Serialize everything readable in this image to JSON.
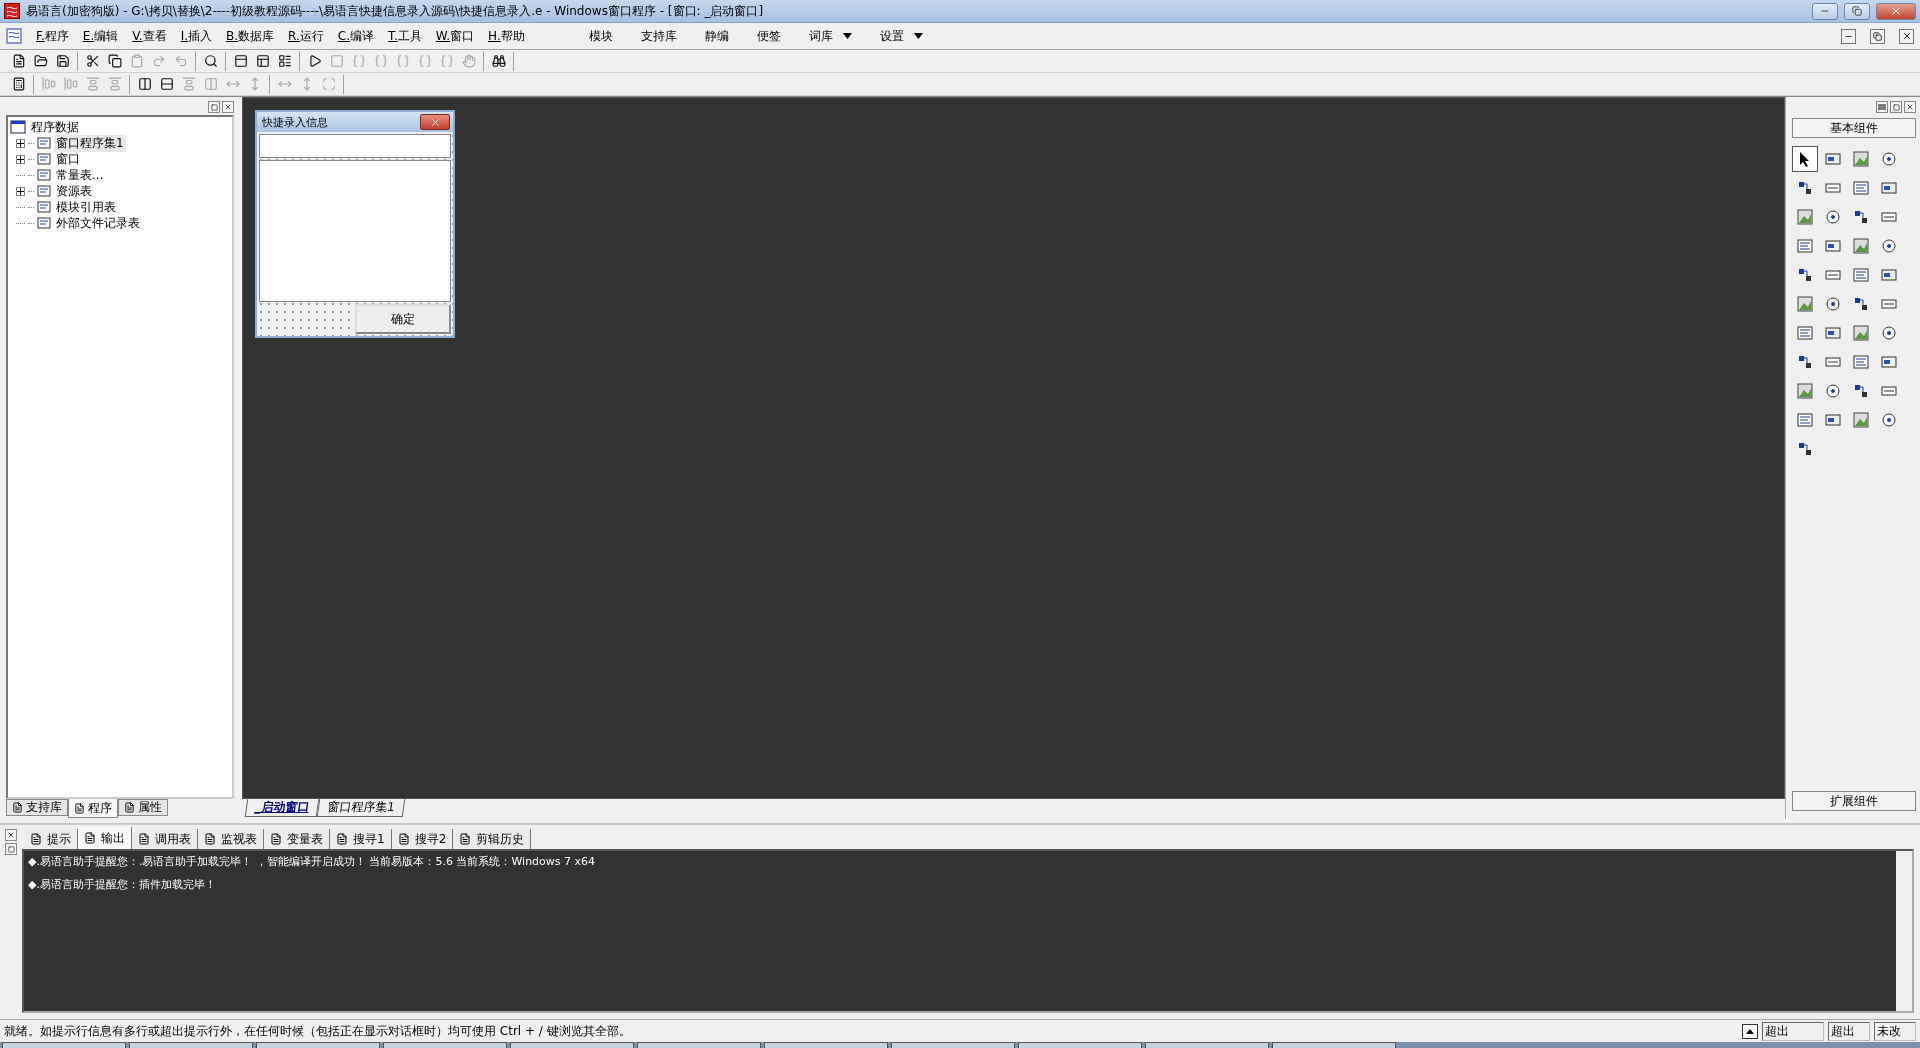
{
  "window": {
    "title": "易语言(加密狗版) - G:\\拷贝\\替换\\2----初级教程源码----\\易语言快捷信息录入源码\\快捷信息录入.e - Windows窗口程序 - [窗口: _启动窗口]"
  },
  "menu": {
    "items": [
      "F.程序",
      "E.编辑",
      "V.查看",
      "I.插入",
      "B.数据库",
      "R.运行",
      "C.编译",
      "T.工具",
      "W.窗口",
      "H.帮助"
    ],
    "extras": [
      {
        "label": "模块",
        "dropdown": false
      },
      {
        "label": "支持库",
        "dropdown": false
      },
      {
        "label": "静编",
        "dropdown": false
      },
      {
        "label": "便签",
        "dropdown": false
      },
      {
        "label": "词库",
        "dropdown": true
      },
      {
        "label": "设置",
        "dropdown": true
      }
    ]
  },
  "toolbars": [
    [
      [
        {
          "disabled": false
        },
        {
          "disabled": false
        },
        {
          "disabled": false
        }
      ],
      [
        {
          "disabled": false
        },
        {
          "disabled": false
        },
        {
          "disabled": true
        },
        {
          "disabled": true
        },
        {
          "disabled": true
        }
      ],
      [
        {
          "disabled": false
        }
      ],
      [
        {
          "disabled": false
        },
        {
          "disabled": false
        },
        {
          "disabled": false
        }
      ],
      [
        {
          "disabled": false
        },
        {
          "disabled": true
        },
        {
          "disabled": true
        },
        {
          "disabled": true
        },
        {
          "disabled": true
        },
        {
          "disabled": true
        },
        {
          "disabled": true
        },
        {
          "disabled": true
        }
      ],
      [
        {
          "disabled": false
        }
      ]
    ],
    [
      [
        {
          "disabled": false
        }
      ],
      [
        {
          "disabled": true
        },
        {
          "disabled": true
        },
        {
          "disabled": true
        },
        {
          "disabled": true
        }
      ],
      [
        {
          "disabled": false
        },
        {
          "disabled": false
        },
        {
          "disabled": true
        },
        {
          "disabled": true
        },
        {
          "disabled": true
        },
        {
          "disabled": true
        }
      ],
      [
        {
          "disabled": true
        },
        {
          "disabled": true
        },
        {
          "disabled": true
        }
      ]
    ]
  ],
  "tree": {
    "root": "程序数据",
    "children": [
      {
        "label": "窗口程序集1",
        "expandable": true,
        "selected": true
      },
      {
        "label": "窗口",
        "expandable": true,
        "selected": false
      },
      {
        "label": "常量表...",
        "expandable": false,
        "selected": false
      },
      {
        "label": "资源表",
        "expandable": true,
        "selected": false
      },
      {
        "label": "模块引用表",
        "expandable": false,
        "selected": false
      },
      {
        "label": "外部文件记录表",
        "expandable": false,
        "selected": false
      }
    ]
  },
  "left_tabs": [
    {
      "label": "支持库",
      "selected": false
    },
    {
      "label": "程序",
      "selected": true
    },
    {
      "label": "属性",
      "selected": false
    }
  ],
  "design_window": {
    "title": "快捷录入信息",
    "button": "确定"
  },
  "editor_tabs": [
    {
      "label": "_启动窗口",
      "selected": true
    },
    {
      "label": "窗口程序集1",
      "selected": false
    }
  ],
  "toolbox": {
    "title": "基本组件",
    "footer": "扩展组件",
    "items": [
      {
        "selected": true
      },
      {
        "selected": false
      },
      {
        "selected": false
      },
      {
        "selected": false
      },
      {
        "selected": false
      },
      {
        "selected": false
      },
      {
        "selected": false
      },
      {
        "selected": false
      },
      {
        "selected": false
      },
      {
        "selected": false
      },
      {
        "selected": false
      },
      {
        "selected": false
      },
      {
        "selected": false
      },
      {
        "selected": false
      },
      {
        "selected": false
      },
      {
        "selected": false
      },
      {
        "selected": false
      },
      {
        "selected": false
      },
      {
        "selected": false
      },
      {
        "selected": false
      },
      {
        "selected": false
      },
      {
        "selected": false
      },
      {
        "selected": false
      },
      {
        "selected": false
      },
      {
        "selected": false
      },
      {
        "selected": false
      },
      {
        "selected": false
      },
      {
        "selected": false
      },
      {
        "selected": false
      },
      {
        "selected": false
      },
      {
        "selected": false
      },
      {
        "selected": false
      },
      {
        "selected": false
      },
      {
        "selected": false
      },
      {
        "selected": false
      },
      {
        "selected": false
      },
      {
        "selected": false
      },
      {
        "selected": false
      },
      {
        "selected": false
      },
      {
        "selected": false
      },
      {
        "selected": false
      }
    ]
  },
  "output_tabs": [
    {
      "label": "提示",
      "selected": false
    },
    {
      "label": "输出",
      "selected": true
    },
    {
      "label": "调用表",
      "selected": false
    },
    {
      "label": "监视表",
      "selected": false
    },
    {
      "label": "变量表",
      "selected": false
    },
    {
      "label": "搜寻1",
      "selected": false
    },
    {
      "label": "搜寻2",
      "selected": false
    },
    {
      "label": "剪辑历史",
      "selected": false
    }
  ],
  "output_lines": [
    "◆.易语言助手提醒您：.易语言助手加载完毕！ ，智能编译开启成功！  当前易版本：5.6  当前系统：Windows 7 x64",
    "◆.易语言助手提醒您：插件加载完毕！"
  ],
  "status_bar": {
    "message": "就绪。如提示行信息有多行或超出提示行外，在任何时候（包括正在显示对话框时）均可使用 Ctrl + / 键浏览其全部。",
    "fields": [
      "超出",
      "超出",
      "未改"
    ]
  }
}
